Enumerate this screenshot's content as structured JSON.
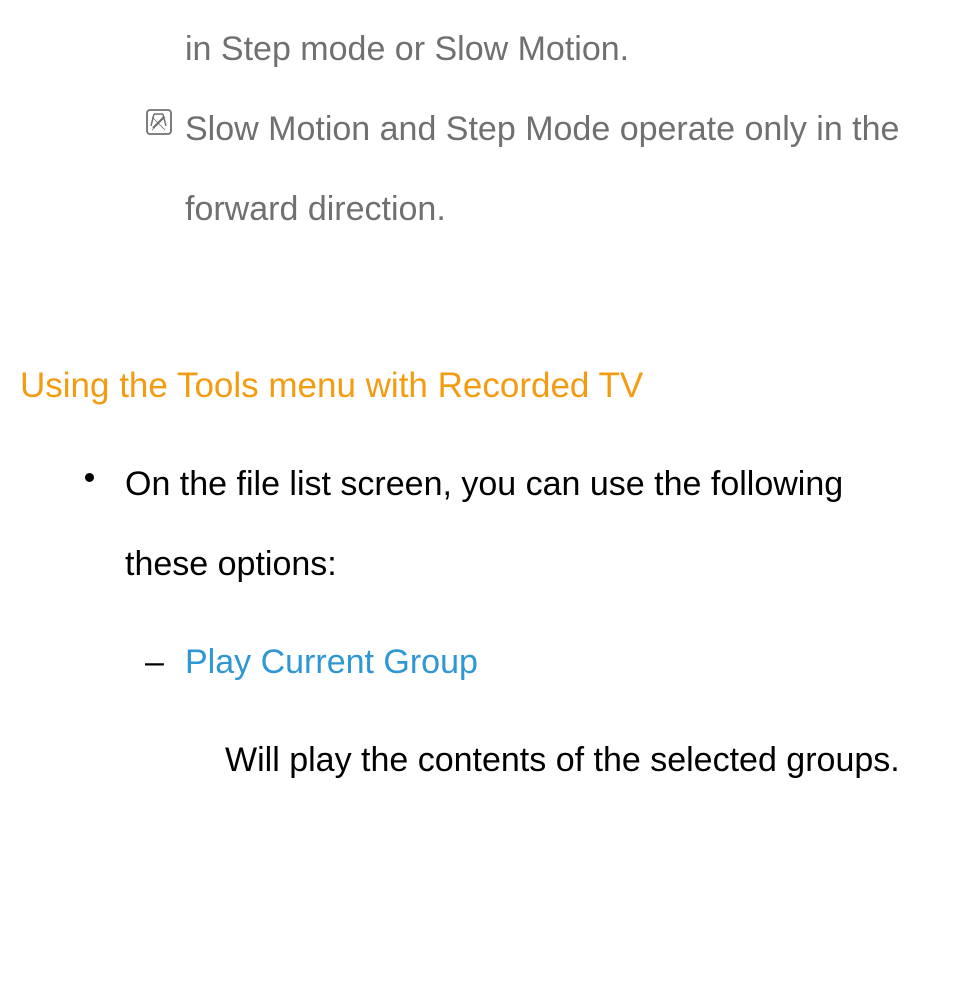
{
  "fragment": {
    "line1": "in Step mode or Slow Motion.",
    "note": "Slow Motion and Step Mode operate only in the forward direction.",
    "note_icon": "note-icon"
  },
  "heading": "Using the Tools menu with Recorded TV",
  "bullet": {
    "text": "On the file list screen, you can use the following these options:",
    "sub": {
      "title": "Play Current Group",
      "desc": "Will play the contents of the selected groups."
    }
  },
  "colors": {
    "muted": "#707070",
    "accent_orange": "#f39c12",
    "accent_blue": "#2e97d4"
  }
}
